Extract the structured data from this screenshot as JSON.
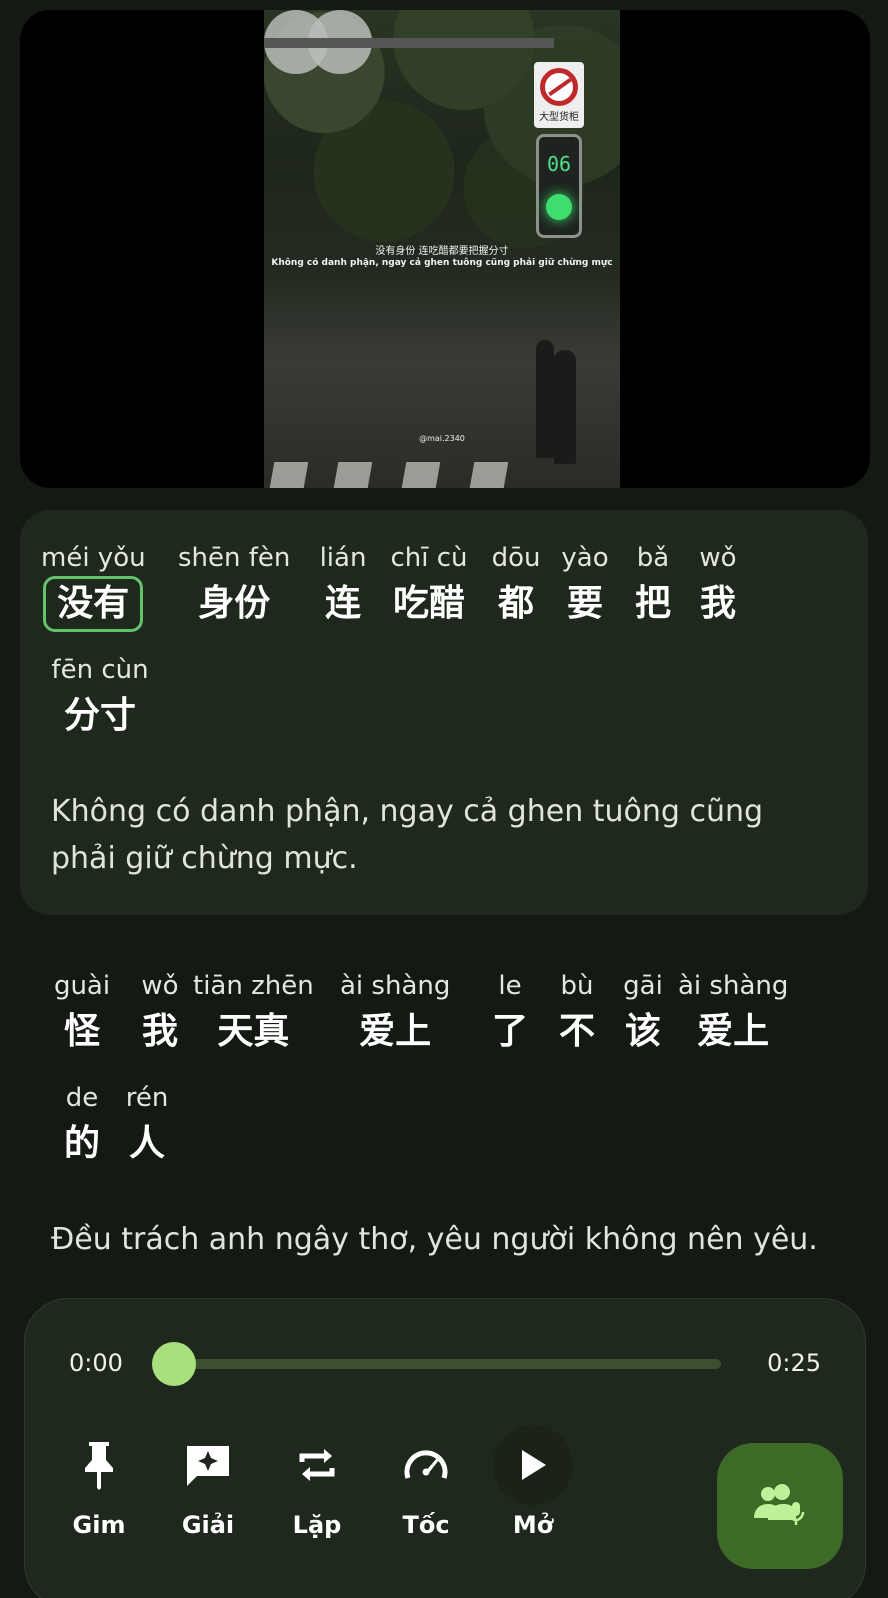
{
  "video": {
    "subtitle_cn": "没有身份 连吃醋都要把握分寸",
    "subtitle_vi": "Không có danh phận, ngay cả ghen tuông cũng phải giữ chừng mực",
    "handle": "@mai.2340",
    "traffic_light_digits": "06",
    "sign_text": "大型货柜"
  },
  "subtitles": [
    {
      "rows": [
        [
          {
            "pinyin": "méi yǒu",
            "hanzi": "没有",
            "selected": true
          },
          {
            "pinyin": "shēn fèn",
            "hanzi": "身份"
          },
          {
            "pinyin": "lián",
            "hanzi": "连"
          },
          {
            "pinyin": "chī cù",
            "hanzi": "吃醋"
          },
          {
            "pinyin": "dōu",
            "hanzi": "都"
          },
          {
            "pinyin": "yào",
            "hanzi": "要"
          },
          {
            "pinyin": "bǎ",
            "hanzi": "把"
          },
          {
            "pinyin": "wǒ",
            "hanzi": "我"
          }
        ],
        [
          {
            "pinyin": "fēn cùn",
            "hanzi": "分寸"
          }
        ]
      ],
      "translation": "Không có danh phận, ngay cả ghen tuông cũng phải giữ chừng mực."
    },
    {
      "rows": [
        [
          {
            "pinyin": "guài",
            "hanzi": "怪"
          },
          {
            "pinyin": "wǒ",
            "hanzi": "我"
          },
          {
            "pinyin": "tiān zhēn",
            "hanzi": "天真"
          },
          {
            "pinyin": "ài shàng",
            "hanzi": "爱上"
          },
          {
            "pinyin": "le",
            "hanzi": "了"
          },
          {
            "pinyin": "bù",
            "hanzi": "不"
          },
          {
            "pinyin": "gāi",
            "hanzi": "该"
          },
          {
            "pinyin": "ài shàng",
            "hanzi": "爱上"
          }
        ],
        [
          {
            "pinyin": "de",
            "hanzi": "的"
          },
          {
            "pinyin": "rén",
            "hanzi": "人"
          }
        ]
      ],
      "translation": "Đều trách anh ngây thơ, yêu người không nên yêu."
    }
  ],
  "player": {
    "current_time": "0:00",
    "duration": "0:25",
    "progress": 0,
    "controls": [
      {
        "label": "Gim",
        "icon": "pin-icon"
      },
      {
        "label": "Giải",
        "icon": "explain-icon"
      },
      {
        "label": "Lặp",
        "icon": "repeat-icon"
      },
      {
        "label": "Tốc",
        "icon": "speed-icon"
      },
      {
        "label": "Mở",
        "icon": "play-icon"
      }
    ],
    "voice_icon": "speaker-group-icon"
  },
  "colors": {
    "background": "#141a13",
    "card": "#1f281d",
    "accent": "#a7e07d",
    "selected_border": "#66c26a",
    "voice_button": "#3d6a26"
  }
}
